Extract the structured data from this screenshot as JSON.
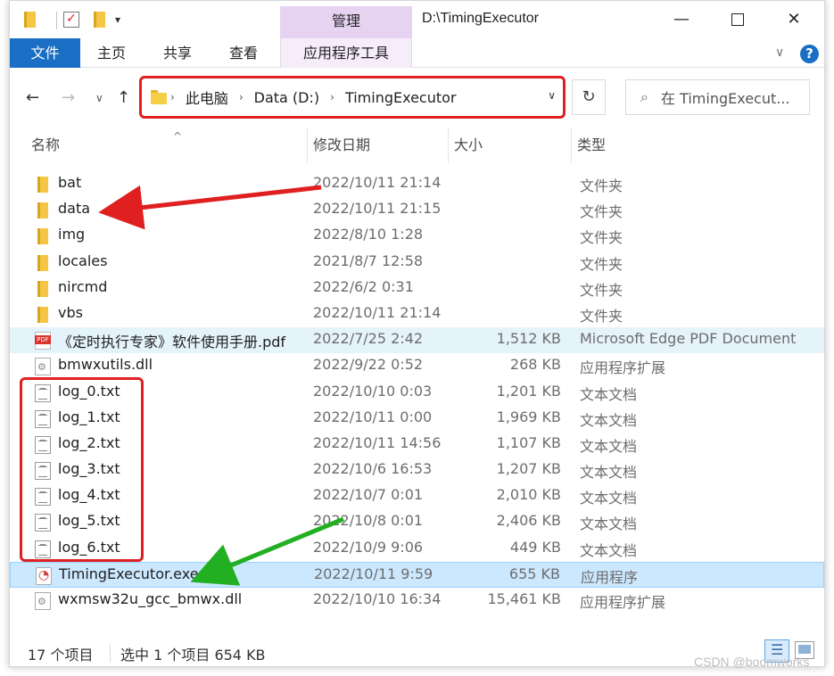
{
  "titlebar": {
    "manage_tab": "管理",
    "window_title": "D:\\TimingExecutor",
    "dropdown_glyph": "▾",
    "minimize_glyph": "—",
    "close_glyph": "✕"
  },
  "ribbon": {
    "tabs": [
      {
        "label": "文件"
      },
      {
        "label": "主页"
      },
      {
        "label": "共享"
      },
      {
        "label": "查看"
      },
      {
        "label": "应用程序工具"
      }
    ],
    "help": "?",
    "collapse_glyph": "∨"
  },
  "nav": {
    "back_glyph": "←",
    "forward_glyph": "→",
    "recent_glyph": "∨",
    "up_glyph": "↑",
    "breadcrumb": [
      "此电脑",
      "Data (D:)",
      "TimingExecutor"
    ],
    "refresh_glyph": "↻",
    "search_placeholder": "在 TimingExecut...",
    "search_glyph": "⌕"
  },
  "columns": {
    "name": "名称",
    "date": "修改日期",
    "size": "大小",
    "type": "类型"
  },
  "files": [
    {
      "name": "bat",
      "date": "2022/10/11 21:14",
      "size": "",
      "type": "文件夹",
      "icon": "folder"
    },
    {
      "name": "data",
      "date": "2022/10/11 21:15",
      "size": "",
      "type": "文件夹",
      "icon": "folder"
    },
    {
      "name": "img",
      "date": "2022/8/10 1:28",
      "size": "",
      "type": "文件夹",
      "icon": "folder"
    },
    {
      "name": "locales",
      "date": "2021/8/7 12:58",
      "size": "",
      "type": "文件夹",
      "icon": "folder"
    },
    {
      "name": "nircmd",
      "date": "2022/6/2 0:31",
      "size": "",
      "type": "文件夹",
      "icon": "folder"
    },
    {
      "name": "vbs",
      "date": "2022/10/11 21:14",
      "size": "",
      "type": "文件夹",
      "icon": "folder"
    },
    {
      "name": "《定时执行专家》软件使用手册.pdf",
      "date": "2022/7/25 2:42",
      "size": "1,512 KB",
      "type": "Microsoft Edge PDF Document",
      "icon": "pdf"
    },
    {
      "name": "bmwxutils.dll",
      "date": "2022/9/22 0:52",
      "size": "268 KB",
      "type": "应用程序扩展",
      "icon": "dll"
    },
    {
      "name": "log_0.txt",
      "date": "2022/10/10 0:03",
      "size": "1,201 KB",
      "type": "文本文档",
      "icon": "txt"
    },
    {
      "name": "log_1.txt",
      "date": "2022/10/11 0:00",
      "size": "1,969 KB",
      "type": "文本文档",
      "icon": "txt"
    },
    {
      "name": "log_2.txt",
      "date": "2022/10/11 14:56",
      "size": "1,107 KB",
      "type": "文本文档",
      "icon": "txt"
    },
    {
      "name": "log_3.txt",
      "date": "2022/10/6 16:53",
      "size": "1,207 KB",
      "type": "文本文档",
      "icon": "txt"
    },
    {
      "name": "log_4.txt",
      "date": "2022/10/7 0:01",
      "size": "2,010 KB",
      "type": "文本文档",
      "icon": "txt"
    },
    {
      "name": "log_5.txt",
      "date": "2022/10/8 0:01",
      "size": "2,406 KB",
      "type": "文本文档",
      "icon": "txt"
    },
    {
      "name": "log_6.txt",
      "date": "2022/10/9 9:06",
      "size": "449 KB",
      "type": "文本文档",
      "icon": "txt"
    },
    {
      "name": "TimingExecutor.exe",
      "date": "2022/10/11 9:59",
      "size": "655 KB",
      "type": "应用程序",
      "icon": "exe"
    },
    {
      "name": "wxmsw32u_gcc_bmwx.dll",
      "date": "2022/10/10 16:34",
      "size": "15,461 KB",
      "type": "应用程序扩展",
      "icon": "dll"
    }
  ],
  "status": {
    "item_count": "17 个项目",
    "selection": "选中 1 个项目  654 KB"
  },
  "watermark": "CSDN @boomworks",
  "colors": {
    "accent": "#1a6fc4",
    "manage_tab": "#e6d3f2",
    "annotation_red": "#e02020",
    "annotation_green": "#22b022",
    "selected_row": "#cce8ff",
    "hover_row": "#e5f3fb"
  }
}
